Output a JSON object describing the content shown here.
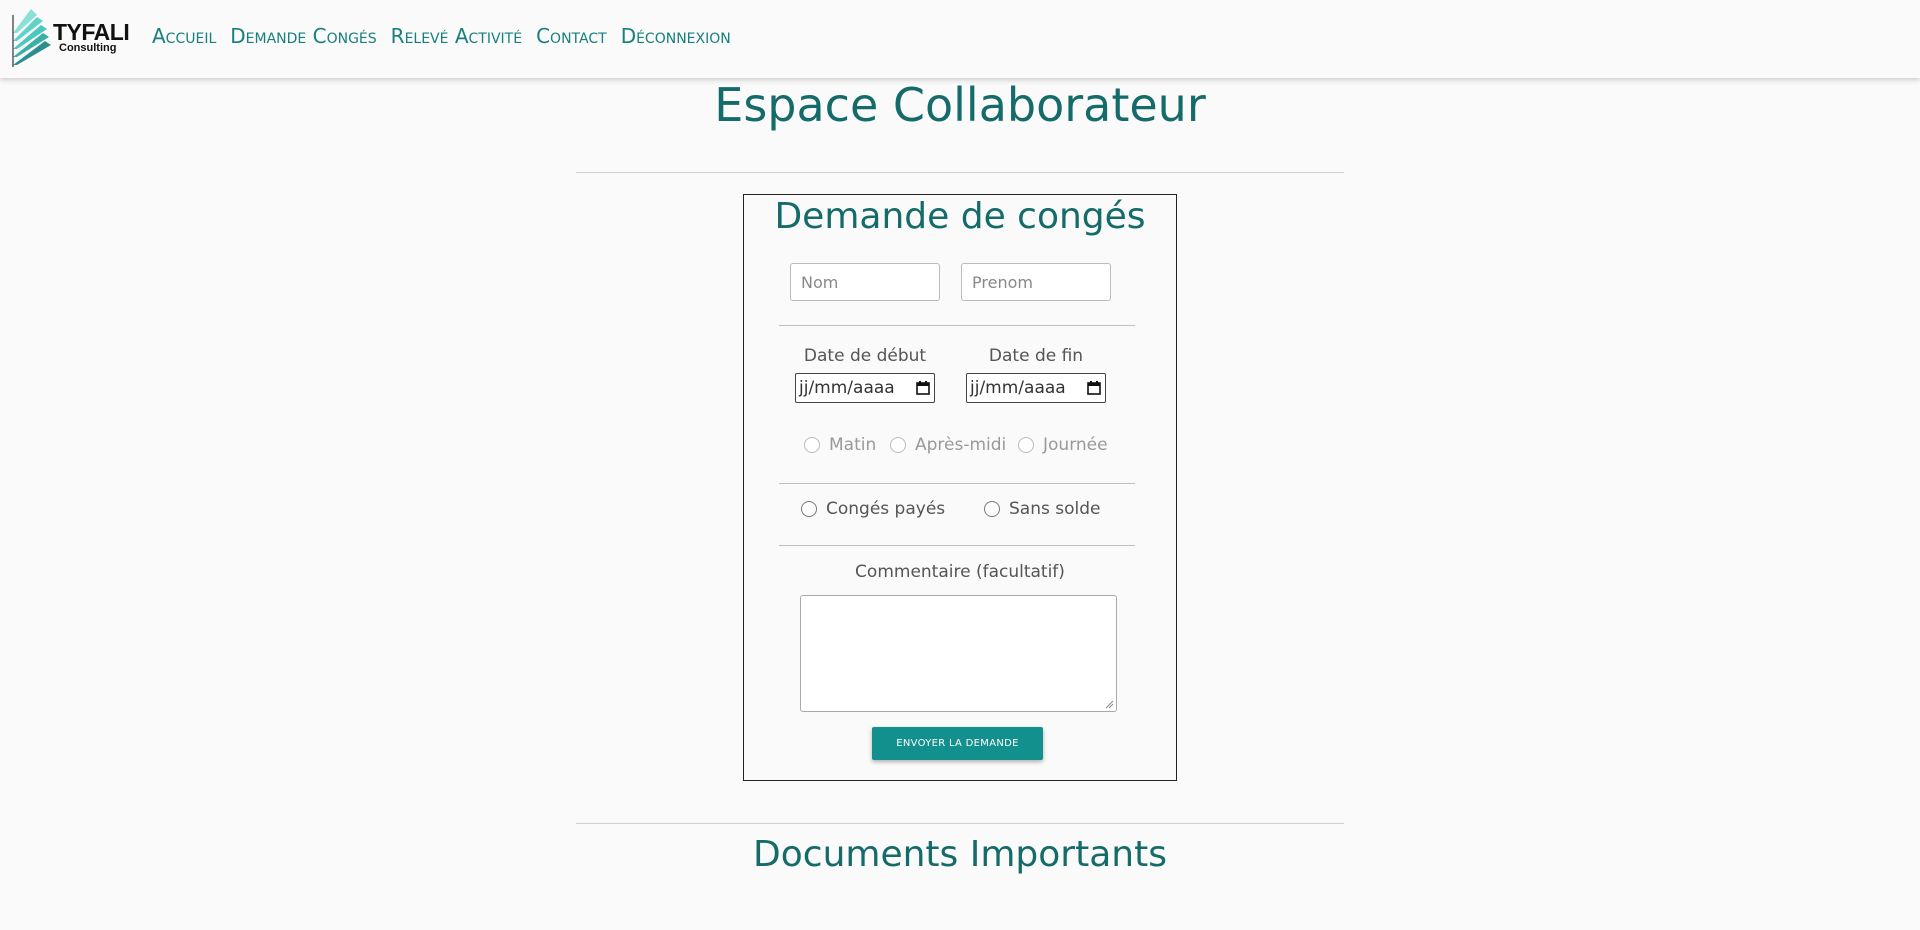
{
  "brand": {
    "name": "TYFALI",
    "subtitle": "Consulting"
  },
  "nav": [
    "Accueil",
    "Demande Congés",
    "Relevé Activité",
    "Contact",
    "Déconnexion"
  ],
  "page_title": "Espace Collaborateur",
  "form": {
    "title": "Demande de congés",
    "nom_placeholder": "Nom",
    "prenom_placeholder": "Prenom",
    "start_label": "Date de début",
    "end_label": "Date de fin",
    "date_format": "jj/mm/aaaa",
    "period_options": [
      "Matin",
      "Après-midi",
      "Journée"
    ],
    "type_options": [
      "Congés payés",
      "Sans solde"
    ],
    "comment_label": "Commentaire (facultatif)",
    "comment_value": "",
    "submit_label": "Envoyer la demande"
  },
  "documents_title": "Documents Importants",
  "colors": {
    "accent": "#146b69",
    "button": "#12908e"
  }
}
